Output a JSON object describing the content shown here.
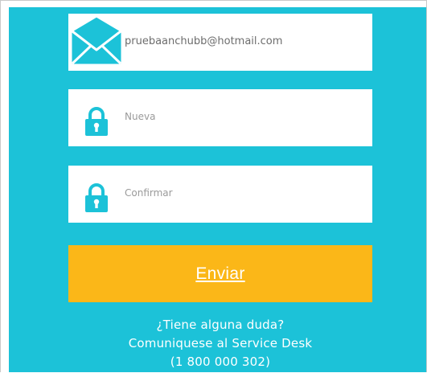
{
  "form": {
    "email": {
      "value": "pruebaanchubb@hotmail.com",
      "icon": "envelope-icon"
    },
    "new_password": {
      "placeholder": "Nueva",
      "icon": "lock-icon"
    },
    "confirm_password": {
      "placeholder": "Confirmar",
      "icon": "lock-icon"
    },
    "submit_label": "Enviar"
  },
  "help": {
    "question": "¿Tiene alguna duda?",
    "contact": "Comuniquese al Service Desk",
    "phone": "(1 800 000 302)"
  },
  "colors": {
    "background": "#1cc2d8",
    "button": "#fbb718",
    "field": "#ffffff"
  }
}
